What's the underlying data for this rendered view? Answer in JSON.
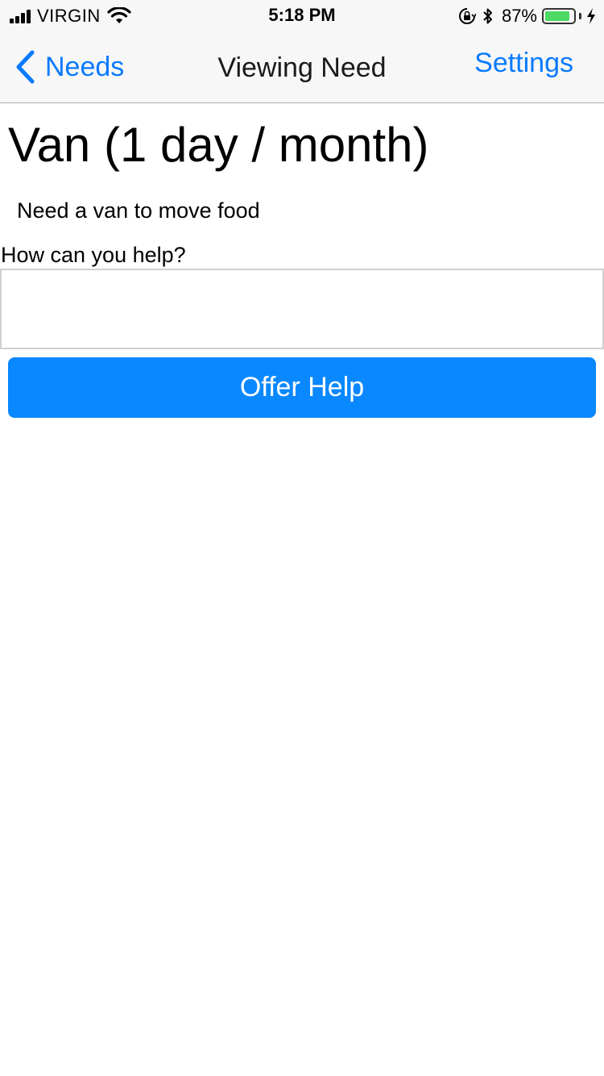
{
  "status_bar": {
    "carrier": "VIRGIN",
    "time": "5:18 PM",
    "battery_percent": "87%",
    "battery_level": 0.87,
    "icons": [
      "signal-icon",
      "wifi-icon",
      "rotation-lock-icon",
      "bluetooth-icon",
      "battery-icon",
      "charging-bolt-icon"
    ]
  },
  "nav": {
    "back_label": "Needs",
    "title": "Viewing Need",
    "settings_label": "Settings"
  },
  "need": {
    "title": "Van (1 day / month)",
    "description": "Need a van to move food"
  },
  "form": {
    "help_label": "How can you help?",
    "help_value": "",
    "help_placeholder": "",
    "submit_label": "Offer Help"
  },
  "colors": {
    "accent": "#0a7aff",
    "button": "#0a88ff",
    "battery": "#4cd964",
    "bar_background": "#f7f7f7"
  }
}
